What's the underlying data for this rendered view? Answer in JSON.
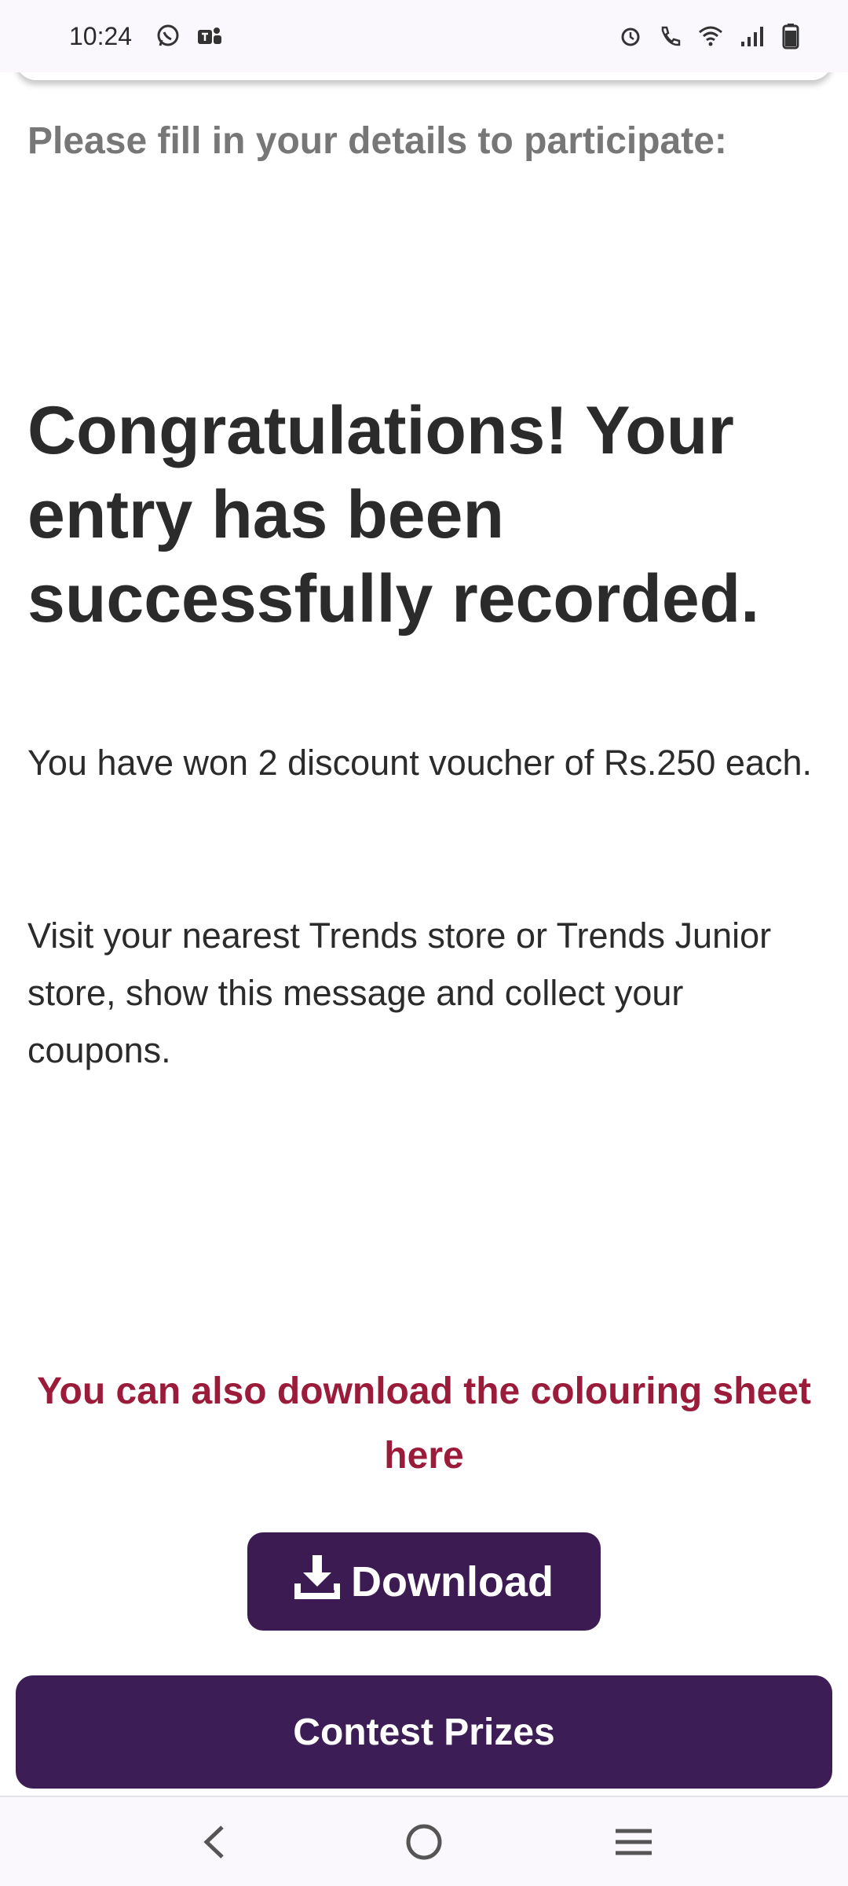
{
  "status_bar": {
    "time": "10:24",
    "left_icons": [
      "whatsapp-icon",
      "teams-icon"
    ],
    "right_icons": [
      "alarm-icon",
      "wifi-call-icon",
      "wifi-icon",
      "signal-icon",
      "battery-icon"
    ]
  },
  "form": {
    "intro": "Please fill in your details to participate:"
  },
  "result": {
    "heading": "Congratulations! Your entry has been successfully recorded.",
    "voucher_message": "You have won 2 discount voucher of Rs.250 each.",
    "instructions": "Visit your nearest Trends store or Trends Junior store, show this message and collect your coupons."
  },
  "download": {
    "note": "You can also download the colouring sheet here",
    "button_label": "Download",
    "icon": "download-icon"
  },
  "contest": {
    "button_label": "Contest Prizes"
  },
  "nav": {
    "back_icon": "back-icon",
    "home_icon": "home-icon",
    "recents_icon": "recents-icon"
  },
  "colors": {
    "accent_purple": "#3c1a52",
    "note_red": "#9b1c3a",
    "text_dark": "#2b2b2b",
    "text_gray": "#777777"
  }
}
